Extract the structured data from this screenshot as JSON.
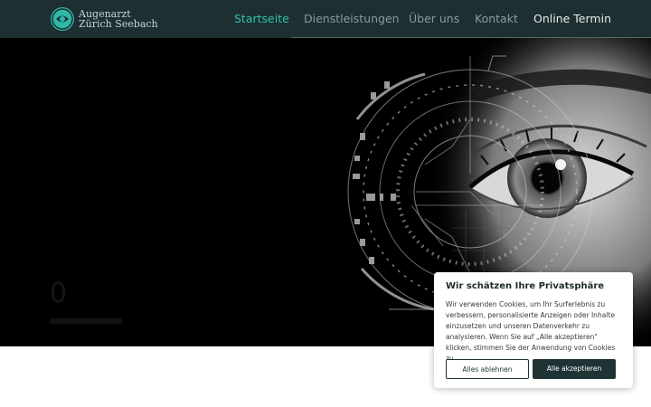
{
  "header": {
    "logo_line1": "Augenarzt",
    "logo_line2": "Zürich Seebach",
    "logo_icon": "eye-logo-icon",
    "nav": [
      {
        "label": "Startseite",
        "active": true
      },
      {
        "label": "Dienstleistungen",
        "active": false
      },
      {
        "label": "Über uns",
        "active": false
      },
      {
        "label": "Kontakt",
        "active": false
      },
      {
        "label": "Online Termin",
        "active": false
      }
    ]
  },
  "hero": {
    "image": "futuristic-eye-scan-illustration",
    "digit": "0"
  },
  "cookie_banner": {
    "title": "Wir schätzen Ihre Privatsphäre",
    "body": "Wir verwenden Cookies, um Ihr Surferlebnis zu verbessern, personalisierte Anzeigen oder Inhalte einzusetzen und unseren Datenverkehr zu analysieren. Wenn Sie auf „Alle akzeptieren\" klicken, stimmen Sie der Anwendung von Cookies zu.",
    "reject_label": "Alles ablehnen",
    "accept_label": "Alle akzeptieren"
  },
  "colors": {
    "header_bg": "#1d2f31",
    "accent": "#2fc0b0",
    "button_dark": "#1f3234"
  }
}
